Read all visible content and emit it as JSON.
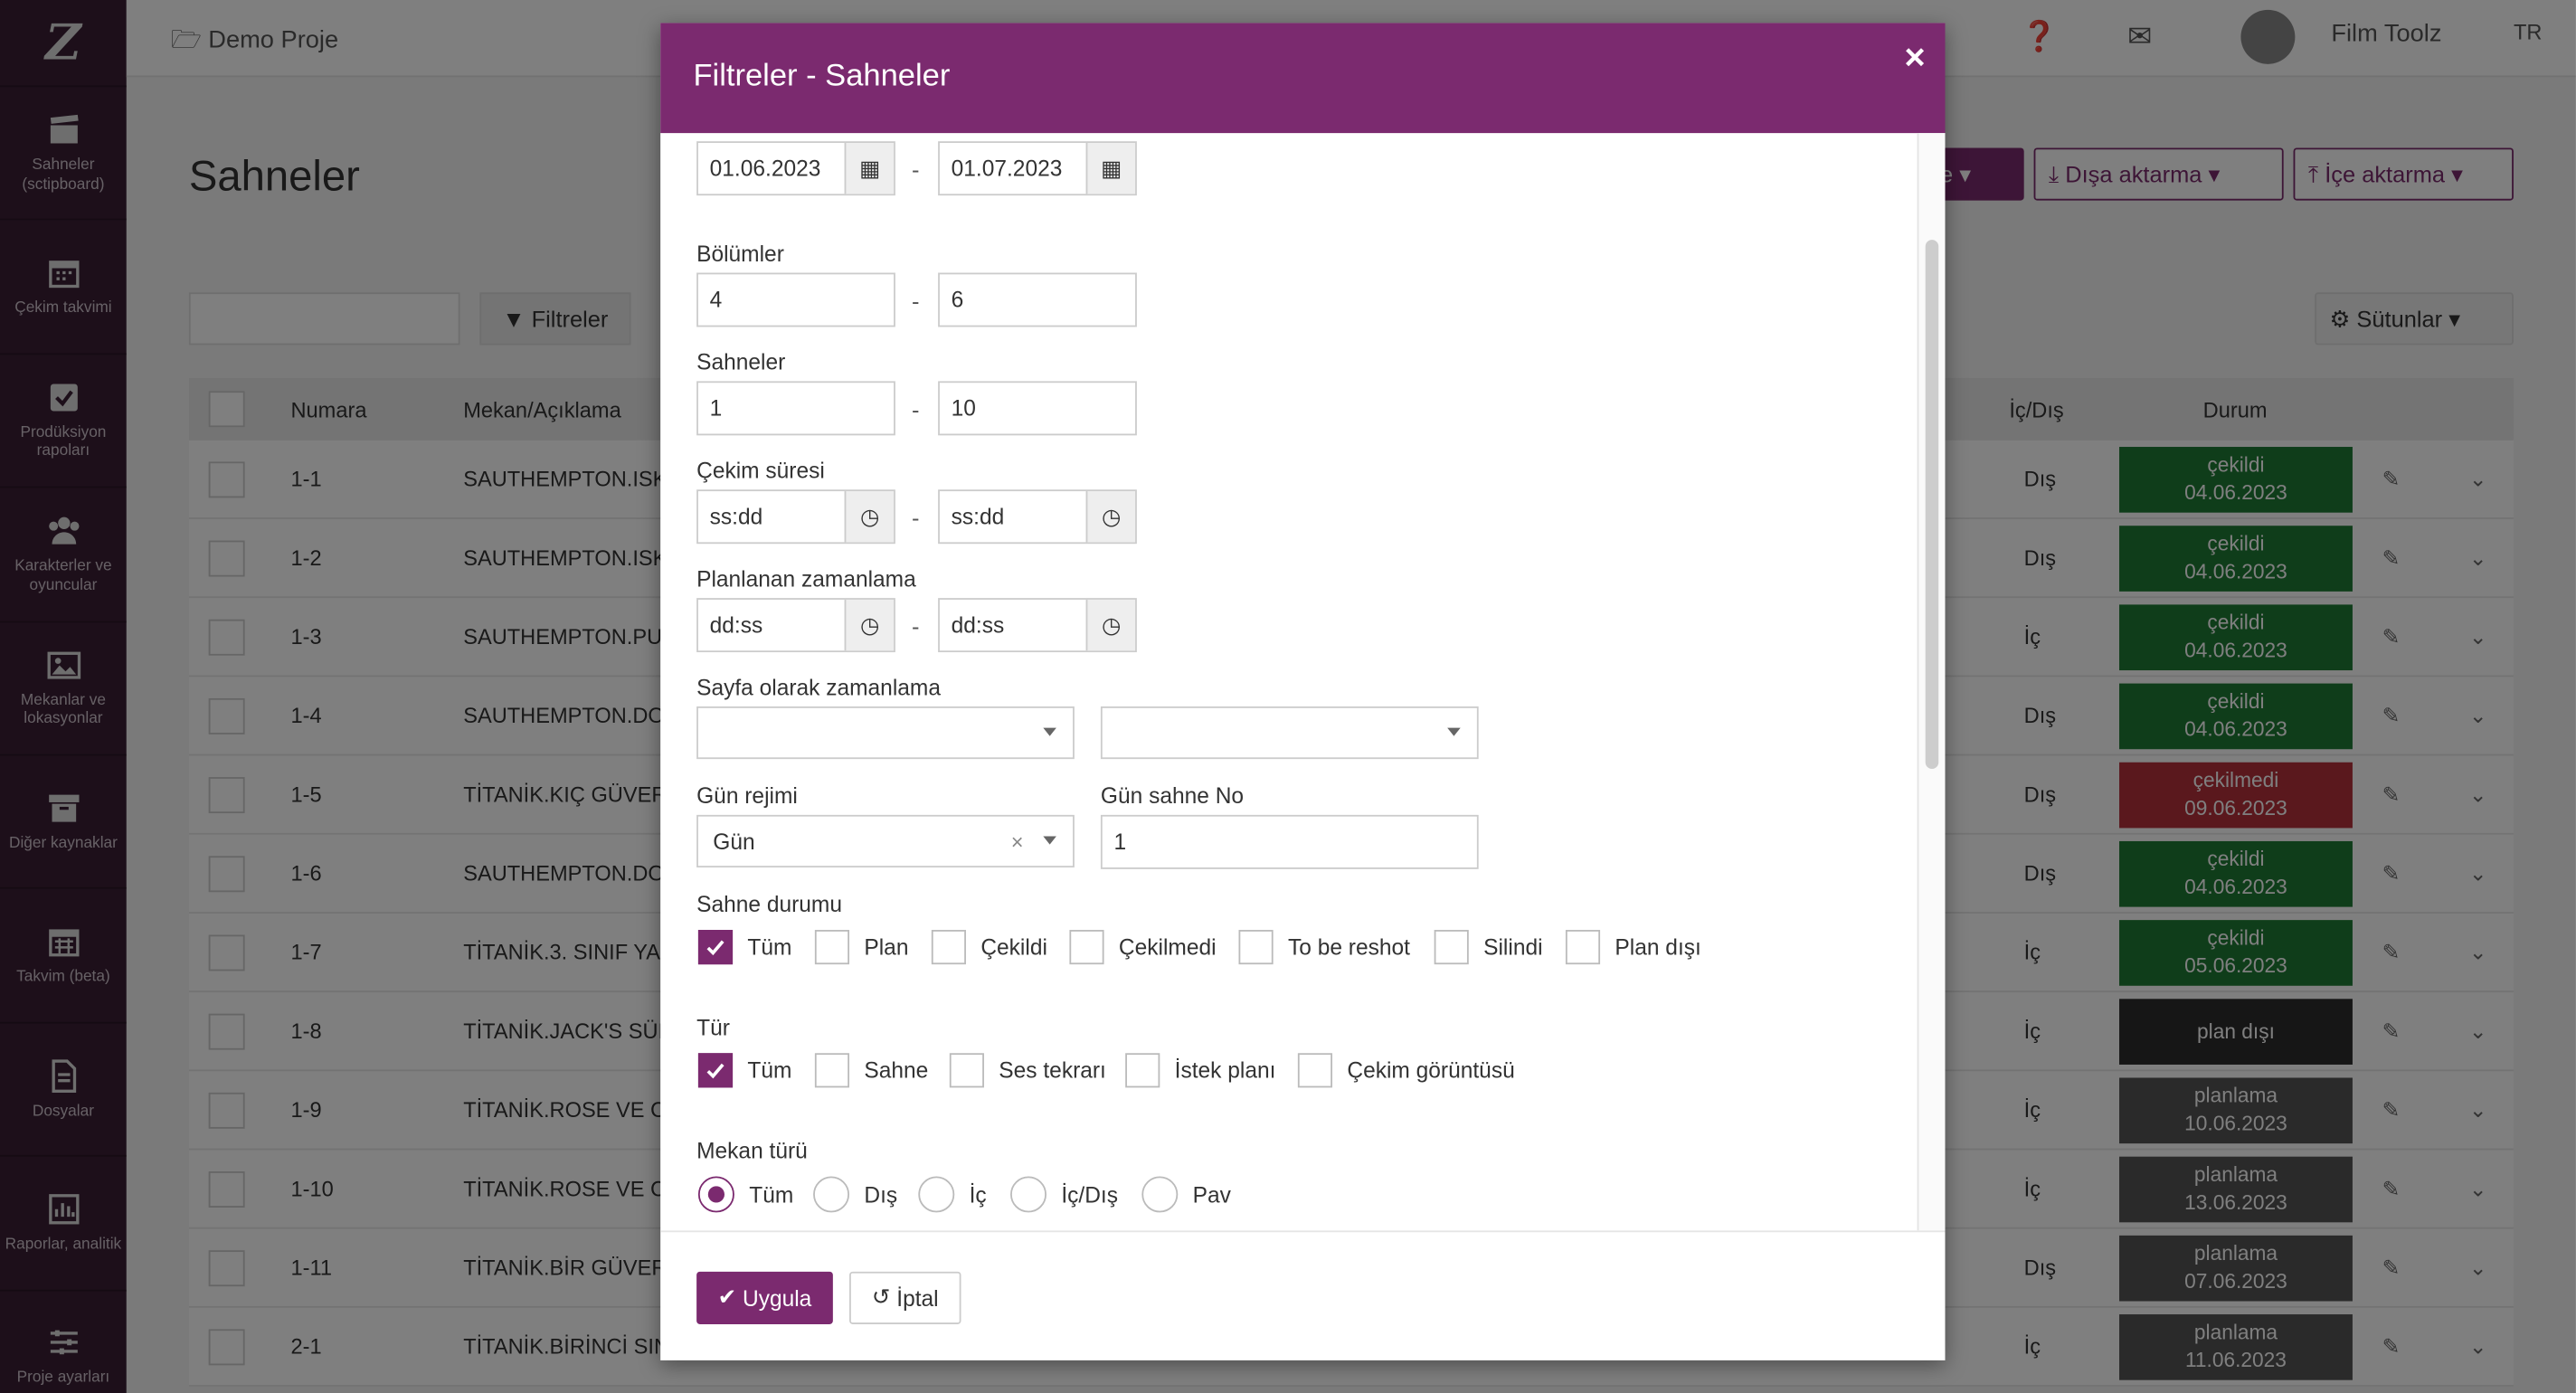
{
  "sidebar": {
    "logo": "Z",
    "items": [
      {
        "icon": "clapperboard-icon",
        "label": "Sahneler (sctipboard)"
      },
      {
        "icon": "calendar-icon",
        "label": "Çekim takvimi"
      },
      {
        "icon": "checkbox-icon",
        "label": "Prodüksiyon rapoları"
      },
      {
        "icon": "people-icon",
        "label": "Karakterler ve oyuncular"
      },
      {
        "icon": "image-icon",
        "label": "Mekanlar ve lokasyonlar"
      },
      {
        "icon": "archive-icon",
        "label": "Diğer kaynaklar"
      },
      {
        "icon": "calendar-grid-icon",
        "label": "Takvim (beta)"
      },
      {
        "icon": "document-icon",
        "label": "Dosyalar"
      },
      {
        "icon": "bar-chart-icon",
        "label": "Raporlar, analitik"
      },
      {
        "icon": "sliders-icon",
        "label": "Proje ayarları"
      }
    ]
  },
  "topbar": {
    "project": "Demo Proje",
    "user": "Film Toolz",
    "lang": "TR"
  },
  "page": {
    "title": "Sahneler",
    "export": "Dışa aktarma",
    "import": "İçe aktarma",
    "filters": "Filtreler",
    "columns": "Sütunlar"
  },
  "table": {
    "headers": {
      "number": "Numara",
      "place": "Mekan/Açıklama",
      "inout": "İç/Dış",
      "status": "Durum"
    },
    "rows": [
      {
        "num": "1-1",
        "place": "SAUTHEMPTON.ISK",
        "io": "Dış",
        "status": "çekildi",
        "date": "04.06.2023",
        "color": "#1e7a34"
      },
      {
        "num": "1-2",
        "place": "SAUTHEMPTON.ISK",
        "io": "Dış",
        "status": "çekildi",
        "date": "04.06.2023",
        "color": "#1e7a34"
      },
      {
        "num": "1-3",
        "place": "SAUTHEMPTON.PUI",
        "io": "İç",
        "status": "çekildi",
        "date": "04.06.2023",
        "color": "#1e7a34"
      },
      {
        "num": "1-4",
        "place": "SAUTHEMPTON.DO",
        "io": "Dış",
        "status": "çekildi",
        "date": "04.06.2023",
        "color": "#1e7a34"
      },
      {
        "num": "1-5",
        "place": "TİTANİK.KIÇ GÜVER",
        "io": "Dış",
        "status": "çekilmedi",
        "date": "09.06.2023",
        "color": "#b5303a"
      },
      {
        "num": "1-6",
        "place": "SAUTHEMPTON.DO",
        "io": "Dış",
        "status": "çekildi",
        "date": "04.06.2023",
        "color": "#1e7a34"
      },
      {
        "num": "1-7",
        "place": "TİTANİK.3. SINIF YA",
        "io": "İç",
        "status": "çekildi",
        "date": "05.06.2023",
        "color": "#1e7a34"
      },
      {
        "num": "1-8",
        "place": "TİTANİK.JACK'S SÜI",
        "io": "İç",
        "status": "plan dışı",
        "date": "",
        "color": "#2c2c2c"
      },
      {
        "num": "1-9",
        "place": "TİTANİK.ROSE VE C",
        "io": "İç",
        "status": "planlama",
        "date": "10.06.2023",
        "color": "#555555"
      },
      {
        "num": "1-10",
        "place": "TİTANİK.ROSE VE C",
        "io": "İç",
        "status": "planlama",
        "date": "13.06.2023",
        "color": "#555555"
      },
      {
        "num": "1-11",
        "place": "TİTANİK.BİR GÜVER",
        "io": "Dış",
        "status": "planlama",
        "date": "07.06.2023",
        "color": "#555555"
      },
      {
        "num": "2-1",
        "place": "TİTANİK.BİRİNCİ SIN",
        "io": "İç",
        "status": "planlama",
        "date": "11.06.2023",
        "color": "#555555"
      }
    ]
  },
  "modal": {
    "title": "Filtreler - Sahneler",
    "date_from": "01.06.2023",
    "date_to": "01.07.2023",
    "episodes_label": "Bölümler",
    "episodes_from": "4",
    "episodes_to": "6",
    "scenes_label": "Sahneler",
    "scenes_from": "1",
    "scenes_to": "10",
    "duration_label": "Çekim süresi",
    "duration_from": "ss:dd",
    "duration_to": "ss:dd",
    "planned_label": "Planlanan zamanlama",
    "planned_from": "dd:ss",
    "planned_to": "dd:ss",
    "page_label": "Sayfa olarak zamanlama",
    "day_regime_label": "Gün rejimi",
    "day_regime_value": "Gün",
    "day_scene_label": "Gün sahne No",
    "day_scene_value": "1",
    "status_label": "Sahne durumu",
    "status_options": [
      {
        "label": "Tüm",
        "checked": true
      },
      {
        "label": "Plan",
        "checked": false
      },
      {
        "label": "Çekildi",
        "checked": false
      },
      {
        "label": "Çekilmedi",
        "checked": false
      },
      {
        "label": "To be reshot",
        "checked": false
      },
      {
        "label": "Silindi",
        "checked": false
      },
      {
        "label": "Plan dışı",
        "checked": false
      }
    ],
    "type_label": "Tür",
    "type_options": [
      {
        "label": "Tüm",
        "checked": true
      },
      {
        "label": "Sahne",
        "checked": false
      },
      {
        "label": "Ses tekrarı",
        "checked": false
      },
      {
        "label": "İstek planı",
        "checked": false
      },
      {
        "label": "Çekim görüntüsü",
        "checked": false
      }
    ],
    "place_label": "Mekan türü",
    "place_options": [
      {
        "label": "Tüm",
        "checked": true
      },
      {
        "label": "Dış",
        "checked": false
      },
      {
        "label": "İç",
        "checked": false
      },
      {
        "label": "İç/Dış",
        "checked": false
      },
      {
        "label": "Pav",
        "checked": false
      }
    ],
    "apply": "Uygula",
    "cancel": "İptal"
  },
  "colors": {
    "accent": "#7b2a6f",
    "sidebar": "#3a1f35"
  }
}
